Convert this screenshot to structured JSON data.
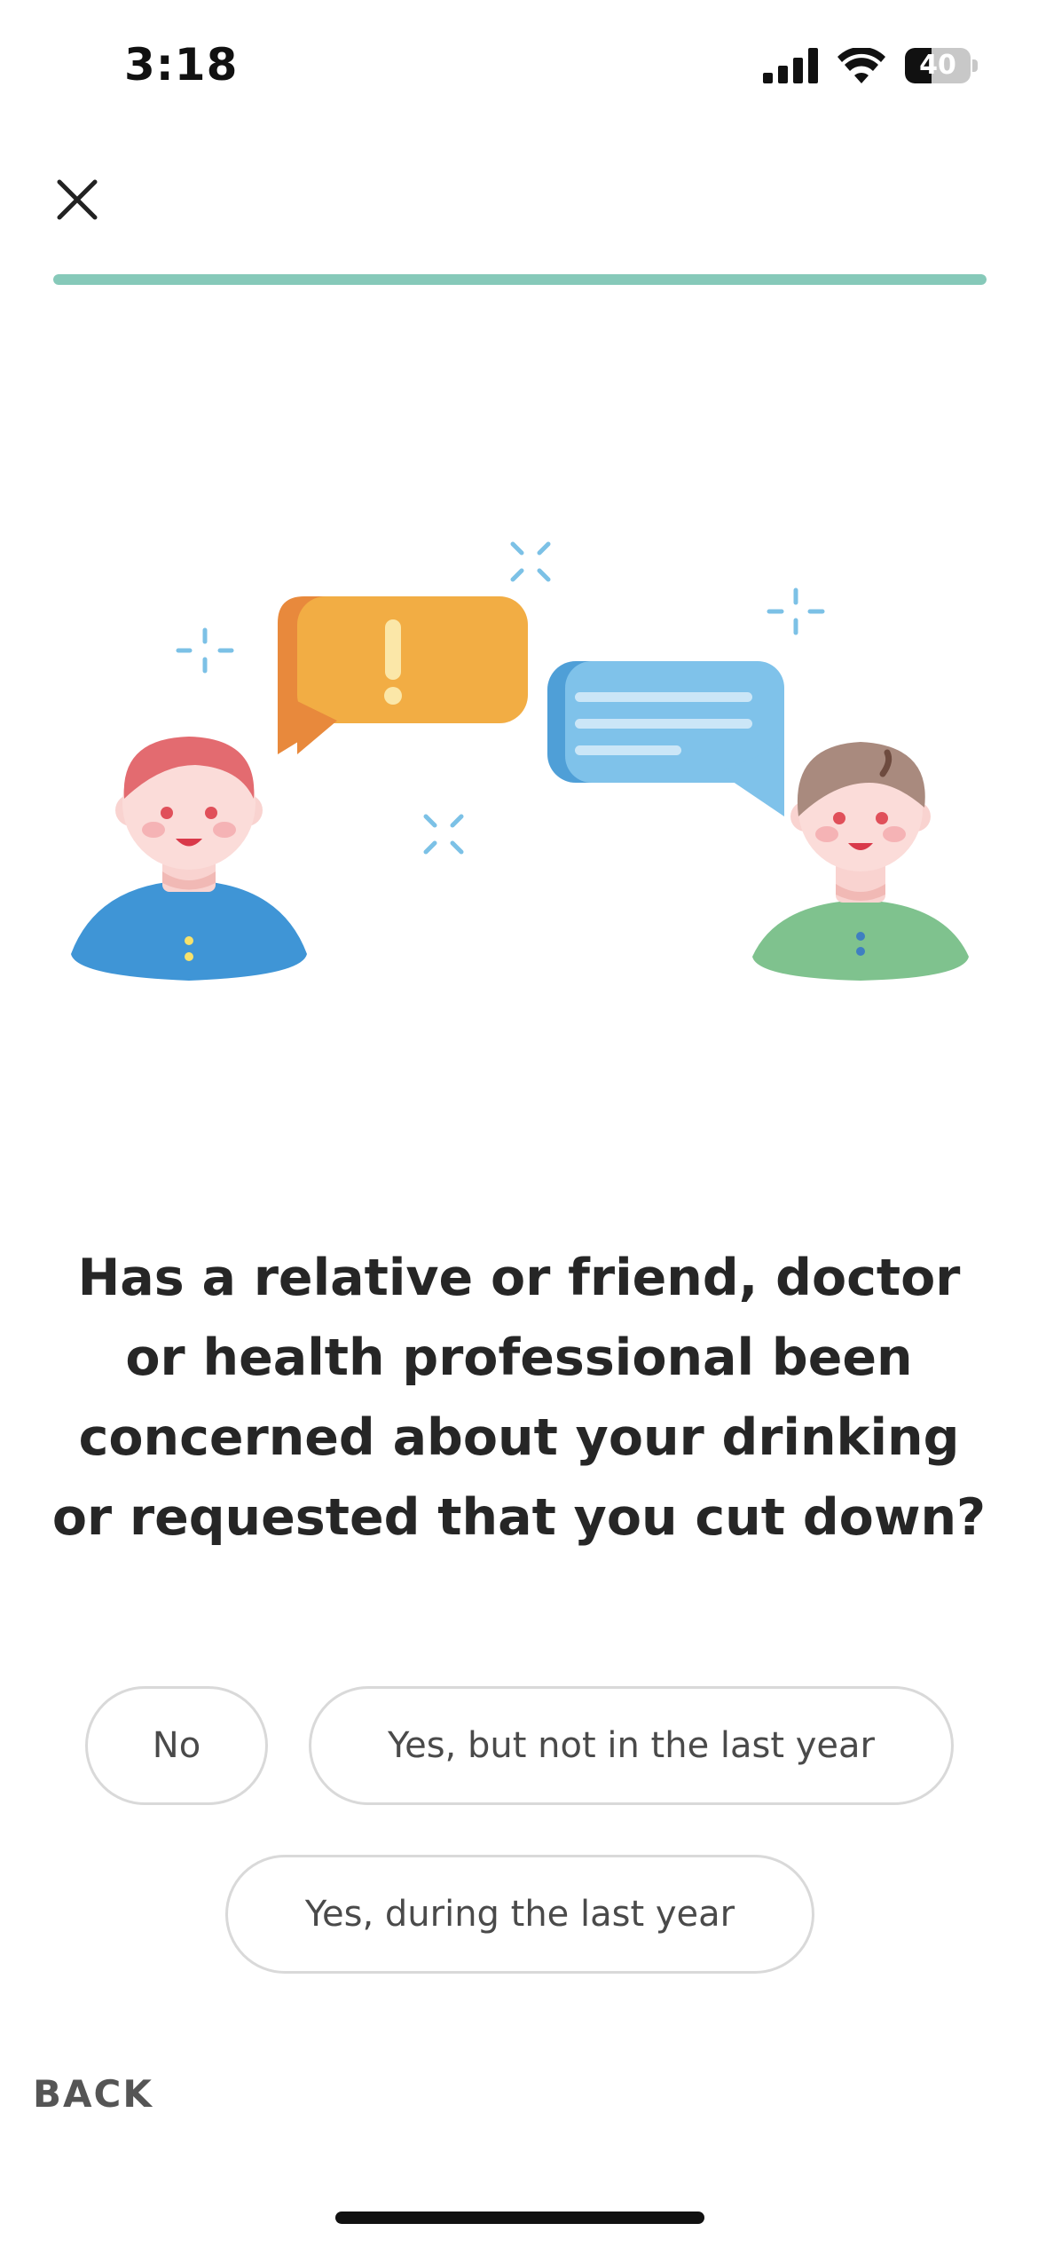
{
  "status_bar": {
    "time": "3:18",
    "battery_level": "40",
    "battery_fraction": 0.4,
    "icons": [
      "cellular-signal-icon",
      "wifi-icon",
      "battery-icon"
    ]
  },
  "header": {
    "close_icon": "close-icon"
  },
  "progress": {
    "fraction": 1.0,
    "color": "#86c9b9"
  },
  "illustration": {
    "name": "two-people-talking-illustration"
  },
  "question": {
    "text": "Has a relative or friend, doctor or health professional been concerned about your drinking or requested that you cut down?"
  },
  "answers": [
    {
      "label": "No"
    },
    {
      "label": "Yes, but not in the last year"
    },
    {
      "label": "Yes, during the last year"
    }
  ],
  "footer": {
    "back_label": "BACK"
  }
}
